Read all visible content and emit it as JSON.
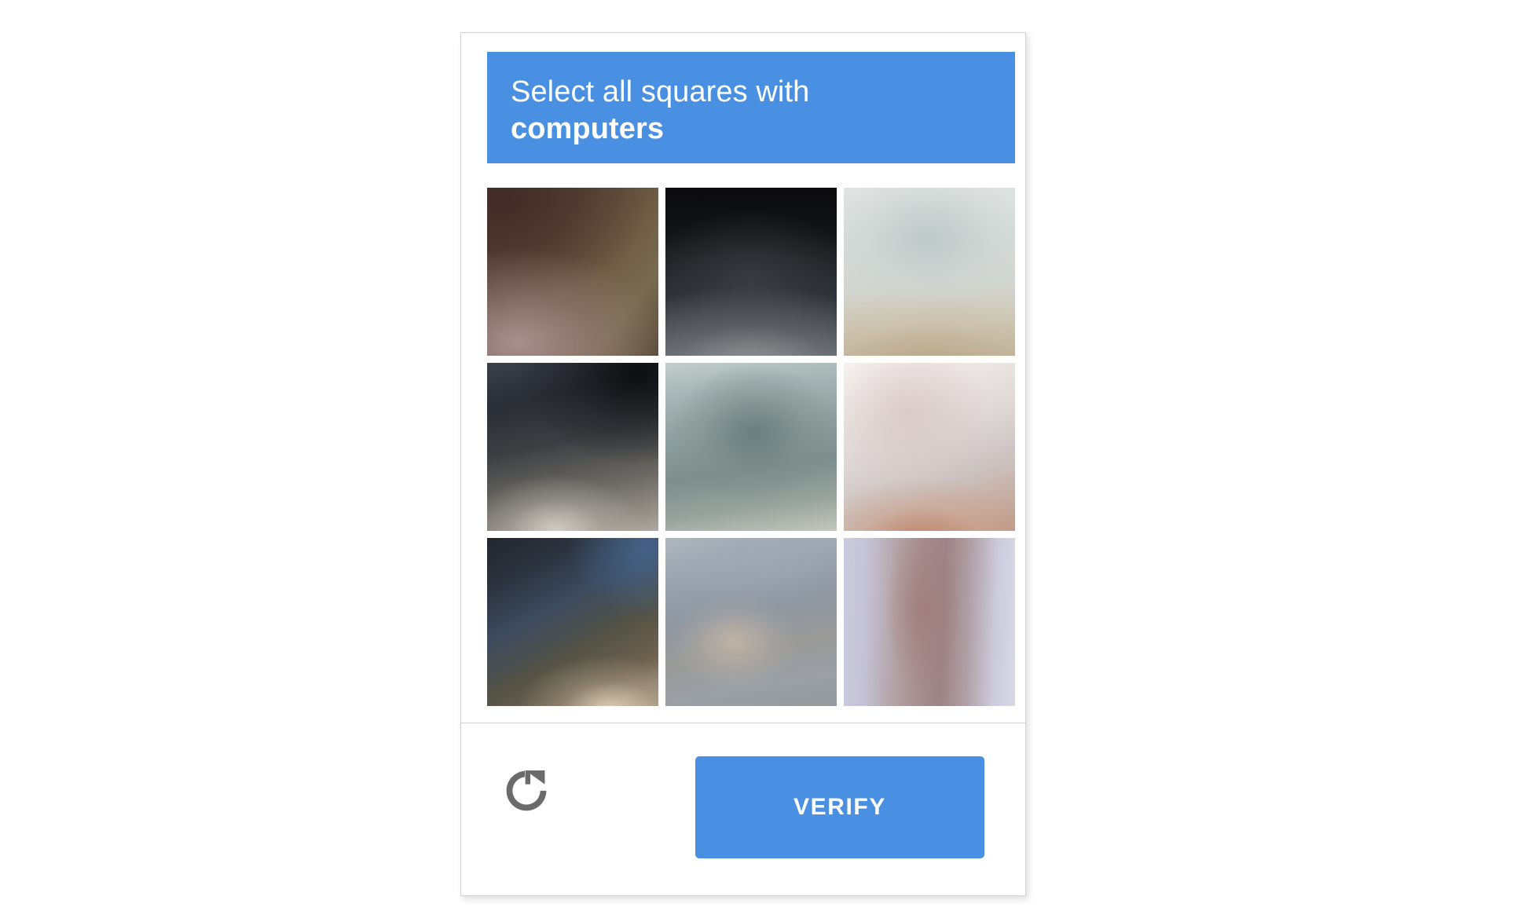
{
  "page": {
    "background_color": "#ffffff"
  },
  "captcha": {
    "accent_color": "#4a90e2",
    "border_color": "#d3d3d3",
    "header": {
      "instruction_prefix": "Select all squares with",
      "target_object": "computers"
    },
    "grid": {
      "rows": 3,
      "columns": 3,
      "tiles": [
        {
          "id": "tile-1",
          "position": "row1-col1",
          "selected": false,
          "description": "blurred dark brown and tan surface"
        },
        {
          "id": "tile-2",
          "position": "row1-col2",
          "selected": false,
          "description": "blurred very dark screen fading to grey"
        },
        {
          "id": "tile-3",
          "position": "row1-col3",
          "selected": false,
          "description": "blurred light grey green and beige"
        },
        {
          "id": "tile-4",
          "position": "row2-col1",
          "selected": false,
          "description": "blurred dark navy grey fading to light grey"
        },
        {
          "id": "tile-5",
          "position": "row2-col2",
          "selected": false,
          "description": "blurred grey green teal panel"
        },
        {
          "id": "tile-6",
          "position": "row2-col3",
          "selected": false,
          "description": "blurred white with pink and tan tones"
        },
        {
          "id": "tile-7",
          "position": "row3-col1",
          "selected": false,
          "description": "blurred dark navy fading to warm tan"
        },
        {
          "id": "tile-8",
          "position": "row3-col2",
          "selected": false,
          "description": "blurred blue grey with warm centre"
        },
        {
          "id": "tile-9",
          "position": "row3-col3",
          "selected": false,
          "description": "blurred lavender and mauve vertical bands"
        }
      ]
    },
    "footer": {
      "refresh_icon": "refresh-icon",
      "refresh_label": "Get a new challenge",
      "verify_label": "VERIFY"
    }
  }
}
